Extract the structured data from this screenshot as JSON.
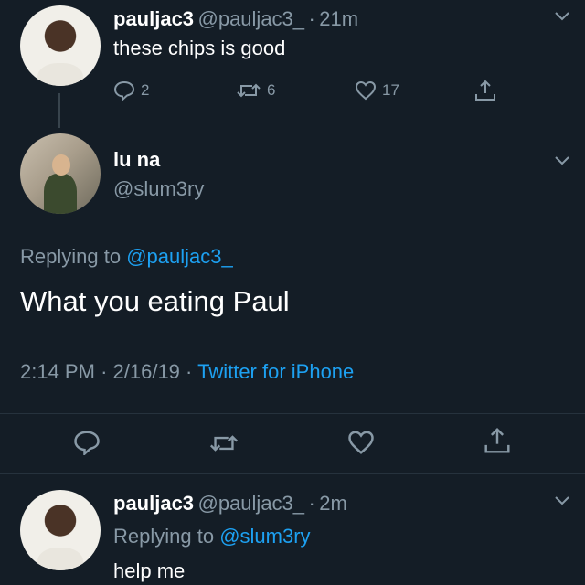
{
  "tweet1": {
    "display_name": "pauljac3",
    "handle": "@pauljac3_",
    "sep": "·",
    "time": "21m",
    "text": "these chips is good",
    "replies": "2",
    "retweets": "6",
    "likes": "17"
  },
  "main_tweet": {
    "display_name": "lu na",
    "handle": "@slum3ry",
    "replying_prefix": "Replying to",
    "replying_to": "@pauljac3_",
    "text": "What you eating Paul",
    "time": "2:14 PM",
    "sep1": "·",
    "date": "2/16/19",
    "sep2": "·",
    "source": "Twitter for iPhone"
  },
  "tweet3": {
    "display_name": "pauljac3",
    "handle": "@pauljac3_",
    "sep": "·",
    "time": "2m",
    "replying_prefix": "Replying to",
    "replying_to": "@slum3ry",
    "text": "help me"
  },
  "colors": {
    "background": "#141d26",
    "muted": "#8899a6",
    "link": "#1da1f2"
  },
  "icons": [
    "chevron-down-icon",
    "reply-icon",
    "retweet-icon",
    "heart-icon",
    "share-icon"
  ]
}
